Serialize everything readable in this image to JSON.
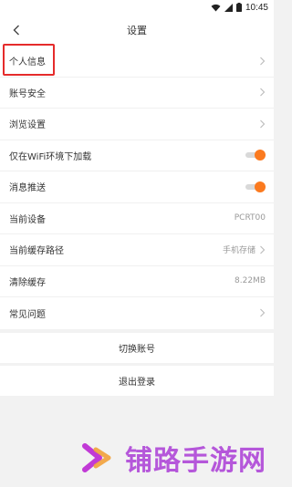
{
  "status_bar": {
    "time": "10:45"
  },
  "nav": {
    "title": "设置"
  },
  "settings": [
    {
      "label": "个人信息",
      "value": "",
      "type": "arrow"
    },
    {
      "label": "账号安全",
      "value": "",
      "type": "arrow"
    },
    {
      "label": "浏览设置",
      "value": "",
      "type": "arrow"
    },
    {
      "label": "仅在WiFi环境下加载",
      "value": "",
      "type": "toggle",
      "on": true
    },
    {
      "label": "消息推送",
      "value": "",
      "type": "toggle",
      "on": true
    },
    {
      "label": "当前设备",
      "value": "PCRT00",
      "type": "text"
    },
    {
      "label": "当前缓存路径",
      "value": "手机存储",
      "type": "arrow"
    },
    {
      "label": "清除缓存",
      "value": "8.22MB",
      "type": "text"
    },
    {
      "label": "常见问题",
      "value": "",
      "type": "arrow"
    }
  ],
  "actions": {
    "switch_account": "切换账号",
    "logout": "退出登录"
  },
  "watermark": {
    "text": "铺路手游网"
  },
  "colors": {
    "accent": "#fb7a1f",
    "highlight": "#e52b2b",
    "watermark": "#b04ad8",
    "background": "#f2f2f2"
  },
  "icons": [
    "wifi-icon",
    "signal-icon",
    "battery-icon",
    "back-arrow-icon",
    "chevron-right-icon",
    "watermark-logo-icon"
  ]
}
